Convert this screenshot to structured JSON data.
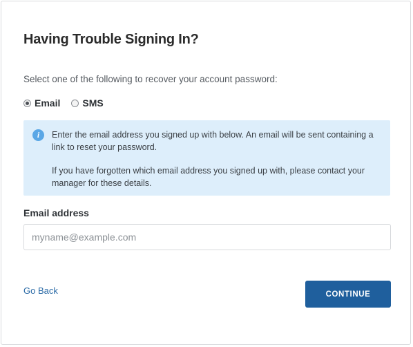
{
  "title": "Having Trouble Signing In?",
  "prompt": "Select one of the following to recover your account password:",
  "recovery_options": [
    {
      "label": "Email",
      "selected": true
    },
    {
      "label": "SMS",
      "selected": false
    }
  ],
  "info": {
    "icon": "info-icon",
    "paragraph1": "Enter the email address you signed up with below. An email will be sent containing a link to reset your password.",
    "paragraph2": "If you have forgotten which email address you signed up with, please contact your manager for these details."
  },
  "email_field": {
    "label": "Email address",
    "value": "",
    "placeholder": "myname@example.com"
  },
  "actions": {
    "back_label": "Go Back",
    "continue_label": "CONTINUE"
  },
  "colors": {
    "primary": "#1f5f9d",
    "info_bg": "#ddeefb",
    "info_icon": "#5aa7e6",
    "link": "#2a6aa6"
  }
}
